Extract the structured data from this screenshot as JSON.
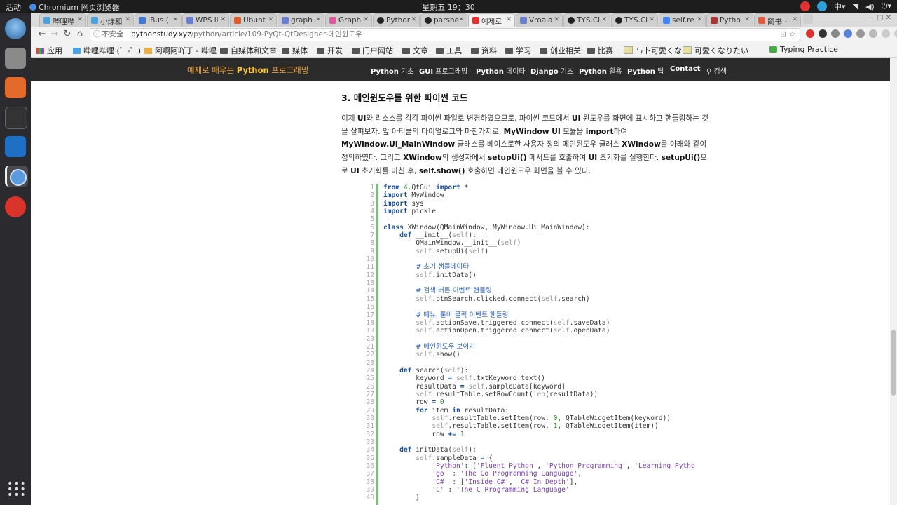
{
  "system": {
    "activities": "活动",
    "app": "Chromium 网页浏览器",
    "clock": "星期五 19：30"
  },
  "tabs": [
    {
      "label": "哔哩哔",
      "active": false
    },
    {
      "label": "小绿和",
      "active": false
    },
    {
      "label": "IBus (",
      "active": false
    },
    {
      "label": "WPS li",
      "active": false
    },
    {
      "label": "Ubunt",
      "active": false
    },
    {
      "label": "graph",
      "active": false
    },
    {
      "label": "Graph",
      "active": false
    },
    {
      "label": "Pythor",
      "active": false
    },
    {
      "label": "parshe",
      "active": false
    },
    {
      "label": "예제로",
      "active": true
    },
    {
      "label": "Vroala",
      "active": false
    },
    {
      "label": "TYS.Cl",
      "active": false
    },
    {
      "label": "TYS.Cl",
      "active": false
    },
    {
      "label": "self.re",
      "active": false
    },
    {
      "label": "Pytho",
      "active": false
    },
    {
      "label": "简书 -",
      "active": false
    }
  ],
  "omnibox": {
    "security": "不安全",
    "domain": "pythonstudy.xyz",
    "path": "/python/article/109-PyQt-QtDesigner-메인윈도우"
  },
  "bookmarks": [
    {
      "label": "应用"
    },
    {
      "label": "哔哩哔哩 (゜-゜)"
    },
    {
      "label": "阿啊阿吖丁 - 哔哩"
    },
    {
      "label": "自媒体和文章"
    },
    {
      "label": "媒体"
    },
    {
      "label": "开发"
    },
    {
      "label": "门户网站"
    },
    {
      "label": "文章"
    },
    {
      "label": "工具"
    },
    {
      "label": "资料"
    },
    {
      "label": "学习"
    },
    {
      "label": "创业相关"
    },
    {
      "label": "比赛"
    },
    {
      "label": "ㄣ卜可愛くな"
    },
    {
      "label": "可愛くなりたい"
    },
    {
      "label": "Typing Practice"
    }
  ],
  "site": {
    "brand_pre": "예제로 배우는 ",
    "brand_bold": "Python",
    "brand_post": " 프로그래밍",
    "nav": [
      {
        "bold": "Python",
        "rest": " 기초"
      },
      {
        "bold": "GUI",
        "rest": " 프로그래밍"
      },
      {
        "bold": "Python",
        "rest": " 데이타"
      },
      {
        "bold": "Django",
        "rest": " 기초"
      },
      {
        "bold": "Python",
        "rest": " 활용"
      },
      {
        "bold": "Python",
        "rest": " 팁"
      },
      {
        "bold": "Contact",
        "rest": ""
      },
      {
        "bold": "",
        "rest": "검색"
      }
    ]
  },
  "article": {
    "heading": "3. 메인윈도우를 위한 파이썬 코드"
  },
  "code_lines": [
    "from PyQt4.QtGui import *",
    "import MyWindow",
    "import sys",
    "import pickle",
    "",
    "class XWindow(QMainWindow, MyWindow.Ui_MainWindow):",
    "    def __init__(self):",
    "        QMainWindow.__init__(self)",
    "        self.setupUi(self)",
    "",
    "        # 초기 샘플데이타",
    "        self.initData()",
    "",
    "        # 검색 버튼 이벤트 핸들링",
    "        self.btnSearch.clicked.connect(self.search)",
    "",
    "        # 메뉴, 툴바 클릭 이벤트 핸들링",
    "        self.actionSave.triggered.connect(self.saveData)",
    "        self.actionOpen.triggered.connect(self.openData)",
    "",
    "        # 메인윈도우 보이기",
    "        self.show()",
    "",
    "    def search(self):",
    "        keyword = self.txtKeyword.text()",
    "        resultData = self.sampleData[keyword]",
    "        self.resultTable.setRowCount(len(resultData))",
    "        row = 0",
    "        for item in resultData:",
    "            self.resultTable.setItem(row, 0, QTableWidgetItem(keyword))",
    "            self.resultTable.setItem(row, 1, QTableWidgetItem(item))",
    "            row += 1",
    "",
    "    def initData(self):",
    "        self.sampleData = {",
    "            'Python': ['Fluent Python', 'Python Programming', 'Learning Pytho",
    "            'go' : 'The Go Programming Language',",
    "            'C#' : ['Inside C#', 'C# In Depth'],",
    "            'C' : 'The C Programming Language'",
    "        }"
  ]
}
